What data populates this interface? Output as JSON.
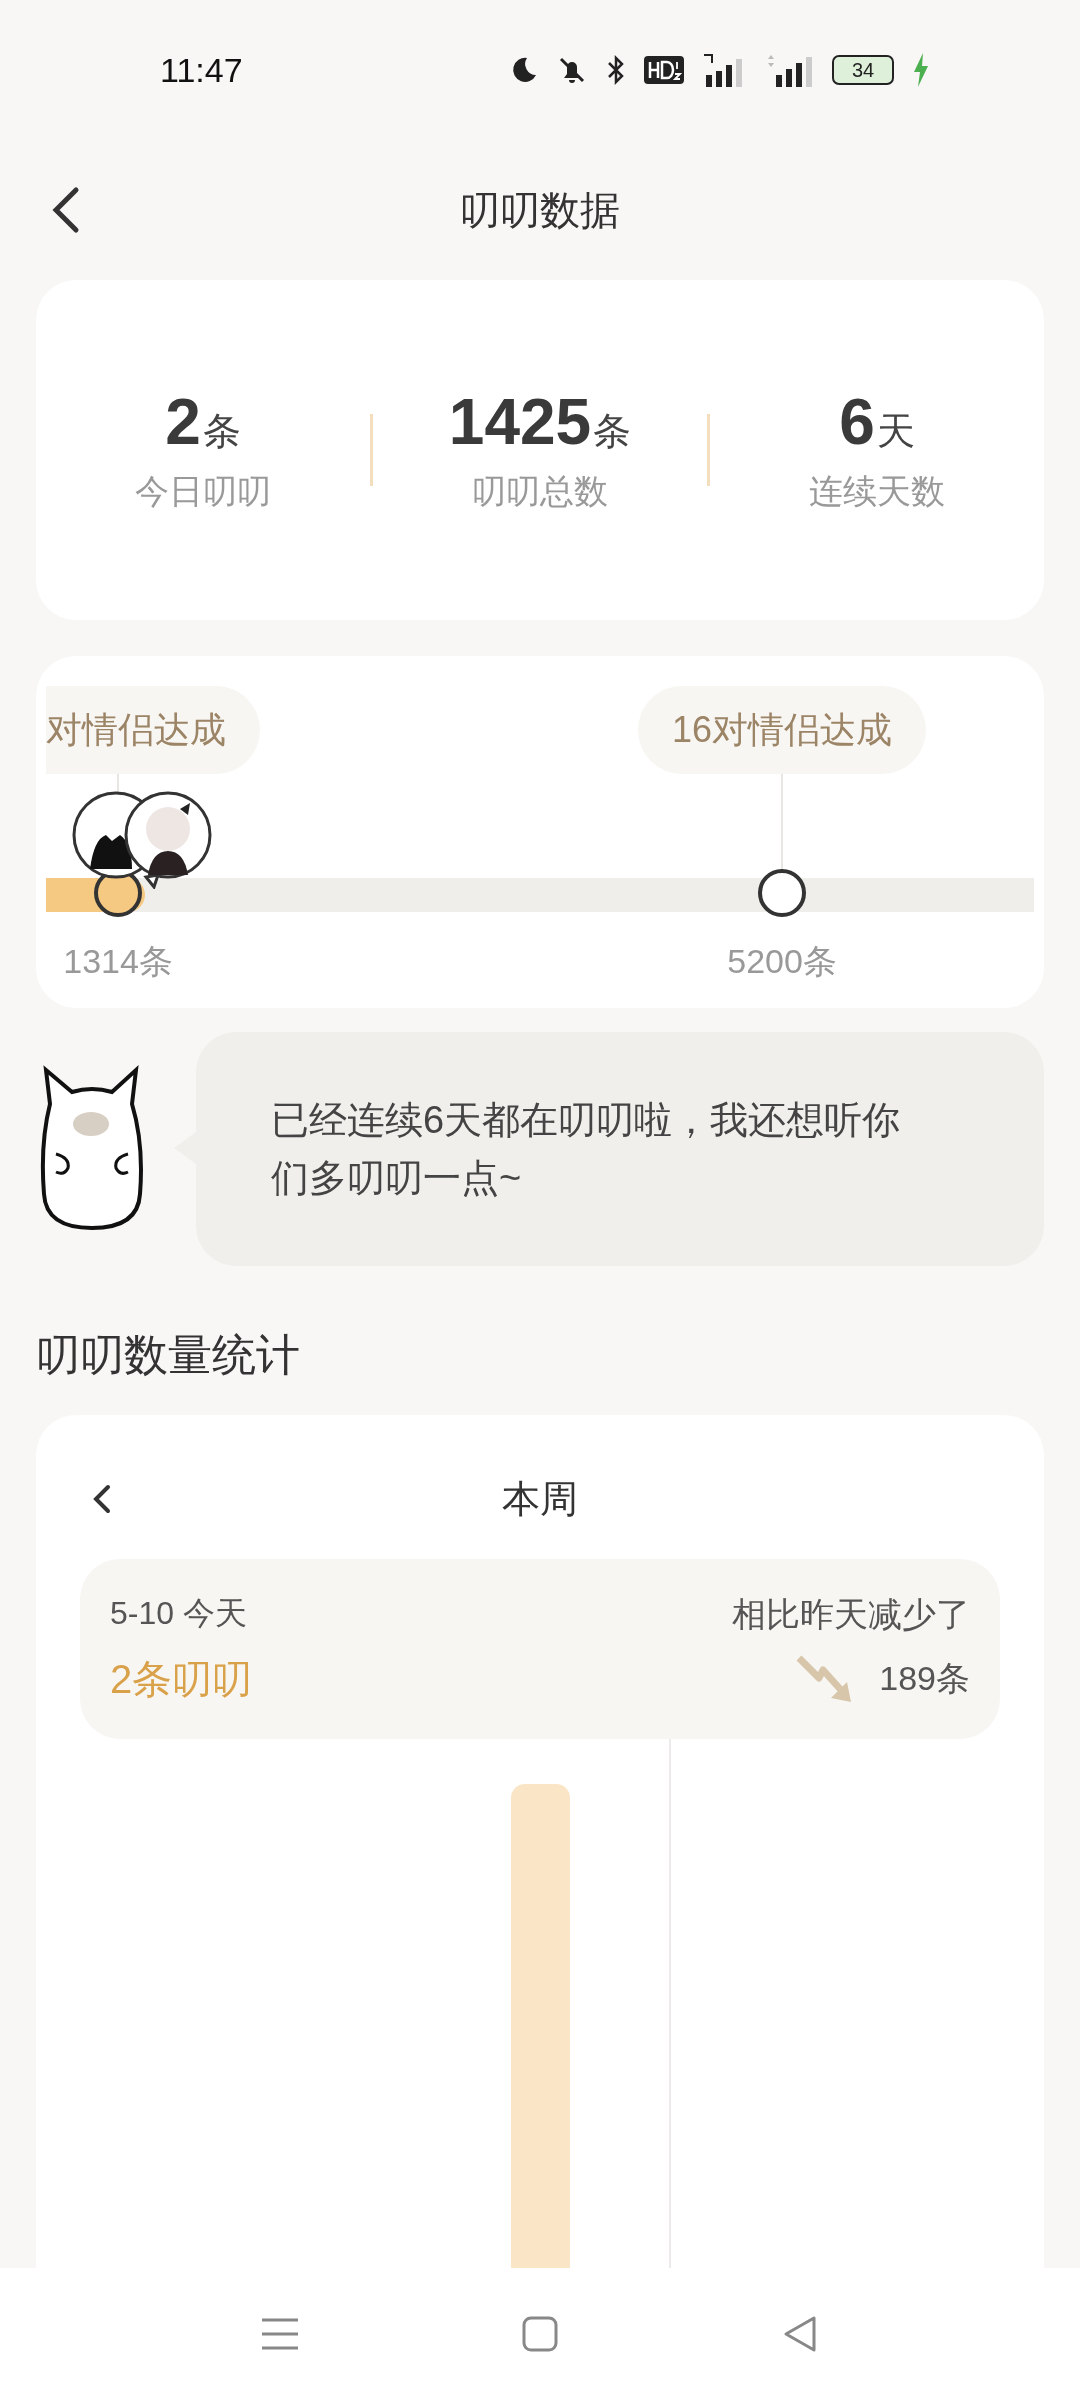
{
  "status_bar": {
    "time": "11:47",
    "battery": "34"
  },
  "header": {
    "title": "叨叨数据"
  },
  "stats": [
    {
      "value": "2",
      "unit": "条",
      "label": "今日叨叨"
    },
    {
      "value": "1425",
      "unit": "条",
      "label": "叨叨总数"
    },
    {
      "value": "6",
      "unit": "天",
      "label": "连续天数"
    }
  ],
  "milestones": {
    "level": 0.1,
    "items": [
      {
        "label": "对情侣达成",
        "count": "1314条",
        "reached": true
      },
      {
        "label": "16对情侣达成",
        "count": "5200条",
        "reached": false
      }
    ]
  },
  "tip": {
    "text": "已经连续6天都在叨叨啦，我还想听你们多叨叨一点~"
  },
  "section_title": "叨叨数量统计",
  "week_chart": {
    "period": "本周",
    "date": "5-10 今天",
    "today_count": "2条叨叨",
    "compare_label": "相比昨天减少了",
    "compare_value": "189条"
  }
}
